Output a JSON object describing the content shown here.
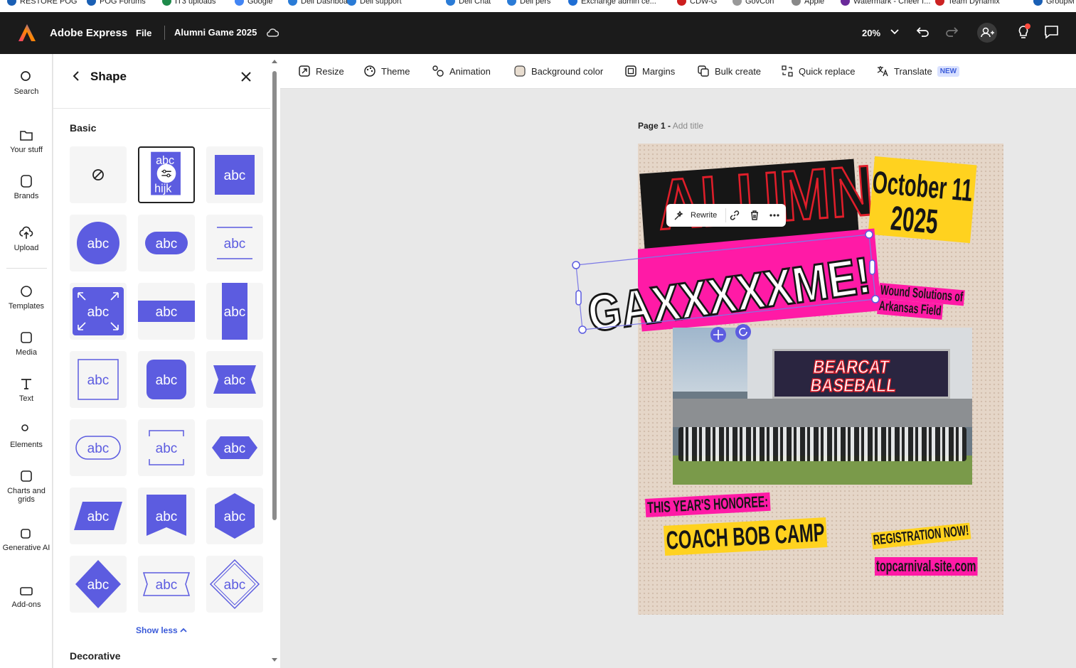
{
  "bookmarks": [
    {
      "label": "RESTORE POG",
      "color": "#1a5fb4"
    },
    {
      "label": "POG Forums",
      "color": "#1a5fb4"
    },
    {
      "label": "IT3 uploads",
      "color": "#1e8a4a"
    },
    {
      "label": "Google",
      "color": "#4285f4"
    },
    {
      "label": "Dell Dashboard",
      "color": "#2a7bd6"
    },
    {
      "label": "Dell support",
      "color": "#2a7bd6"
    },
    {
      "label": "Dell Chat",
      "color": "#2a7bd6"
    },
    {
      "label": "Dell pers",
      "color": "#2a7bd6"
    },
    {
      "label": "Exchange admin ce...",
      "color": "#1f6ed4"
    },
    {
      "label": "CDW-G",
      "color": "#cc1f1f"
    },
    {
      "label": "GovCon",
      "color": "#999999"
    },
    {
      "label": "Apple",
      "color": "#888888"
    },
    {
      "label": "Watermark - Cheer f...",
      "color": "#6a2a9a"
    },
    {
      "label": "Team Dynamix",
      "color": "#cc2222"
    },
    {
      "label": "GroupM",
      "color": "#1a5fb4"
    }
  ],
  "app": {
    "brand": "Adobe Express",
    "file_menu": "File",
    "doc_title": "Alumni Game 2025",
    "zoom": "20%"
  },
  "rail": [
    {
      "label": "Search",
      "icon": "search-icon"
    },
    {
      "label": "Your stuff",
      "icon": "folder-icon"
    },
    {
      "label": "Brands",
      "icon": "brand-icon"
    },
    {
      "label": "Upload",
      "icon": "upload-icon"
    },
    {
      "label": "Templates",
      "icon": "templates-icon"
    },
    {
      "label": "Media",
      "icon": "media-icon"
    },
    {
      "label": "Text",
      "icon": "text-icon"
    },
    {
      "label": "Elements",
      "icon": "elements-icon"
    },
    {
      "label": "Charts and grids",
      "icon": "charts-icon"
    },
    {
      "label": "Generative AI",
      "icon": "generative-ai-icon"
    },
    {
      "label": "Add-ons",
      "icon": "add-ons-icon"
    }
  ],
  "panel": {
    "title": "Shape",
    "section_basic": "Basic",
    "show_less": "Show less",
    "section_decorative": "Decorative",
    "tile_text": "abc",
    "tile_text_alt": "hijk",
    "accent": "#5c5ce0"
  },
  "toolbar": [
    {
      "label": "Resize",
      "icon": "resize-icon"
    },
    {
      "label": "Theme",
      "icon": "theme-icon"
    },
    {
      "label": "Animation",
      "icon": "animation-icon"
    },
    {
      "label": "Background color",
      "icon": "background-color-icon"
    },
    {
      "label": "Margins",
      "icon": "margins-icon"
    },
    {
      "label": "Bulk create",
      "icon": "bulk-create-icon"
    },
    {
      "label": "Quick replace",
      "icon": "quick-replace-icon"
    },
    {
      "label": "Translate",
      "icon": "translate-icon",
      "badge": "NEW"
    }
  ],
  "page": {
    "label": "Page 1 -",
    "title_placeholder": "Add title"
  },
  "poster": {
    "headline_1": "ALUMNI",
    "headline_2": "GAXXXXXME!",
    "date_1": "October 11",
    "date_2": "2025",
    "venue_1": "Wound Solutions of",
    "venue_2": "Arkansas Field",
    "photo_sign_1": "BEARCAT",
    "photo_sign_2": "BASEBALL",
    "honoree_label": "THIS YEAR'S HONOREE:",
    "honoree_name": "COACH BOB CAMP",
    "cta": "REGISTRATION NOW!",
    "url": "topcarnival.site.com",
    "colors": {
      "pink": "#ff1aa6",
      "yellow": "#ffd21f",
      "black": "#161616",
      "red": "#e01e2a"
    }
  },
  "float_toolbar": {
    "rewrite": "Rewrite"
  }
}
